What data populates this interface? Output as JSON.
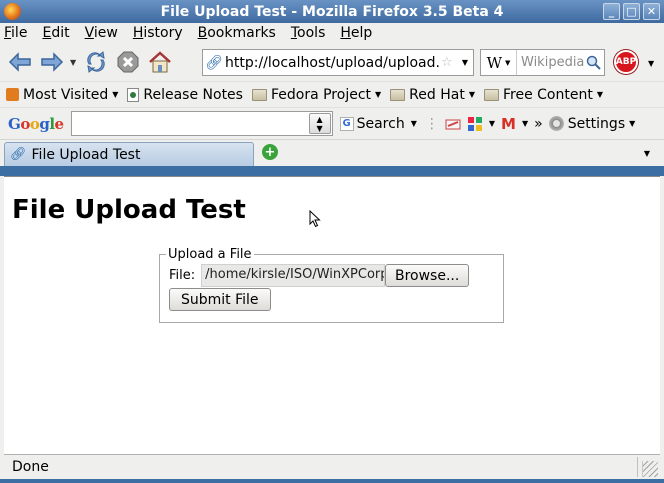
{
  "window": {
    "title": "File Upload Test - Mozilla Firefox 3.5 Beta 4",
    "controls": {
      "minimize": "_",
      "maximize": "□",
      "close": "✕"
    }
  },
  "menu": {
    "items": [
      "File",
      "Edit",
      "View",
      "History",
      "Bookmarks",
      "Tools",
      "Help"
    ]
  },
  "navbar": {
    "url": "http://localhost/upload/upload.",
    "search_engine_icon": "W",
    "search_placeholder": "Wikipedia",
    "adblock_label": "ABP"
  },
  "bookmarks": {
    "items": [
      {
        "label": "Most Visited",
        "icon": "rss-icon",
        "dropdown": true
      },
      {
        "label": "Release Notes",
        "icon": "page-icon",
        "dropdown": false
      },
      {
        "label": "Fedora Project",
        "icon": "folder-icon",
        "dropdown": true
      },
      {
        "label": "Red Hat",
        "icon": "folder-icon",
        "dropdown": true
      },
      {
        "label": "Free Content",
        "icon": "folder-icon",
        "dropdown": true
      }
    ]
  },
  "googlebar": {
    "logo": "Google",
    "input_value": "",
    "search_label": "Search",
    "overflow": "»",
    "settings_label": "Settings"
  },
  "tabs": {
    "items": [
      {
        "label": "File Upload Test",
        "active": true
      }
    ]
  },
  "page": {
    "heading": "File Upload Test",
    "fieldset_legend": "Upload a File",
    "file_label": "File:",
    "file_value": "/home/kirsle/ISO/WinXPCorp",
    "browse_label": "Browse...",
    "submit_label": "Submit File"
  },
  "status": {
    "text": "Done"
  },
  "colors": {
    "titlebar": "#3e6aa0",
    "chrome": "#efefed",
    "tab_active": "#b7cce3",
    "adblock_red": "#d7161d",
    "newtab_green": "#3ba33b"
  }
}
